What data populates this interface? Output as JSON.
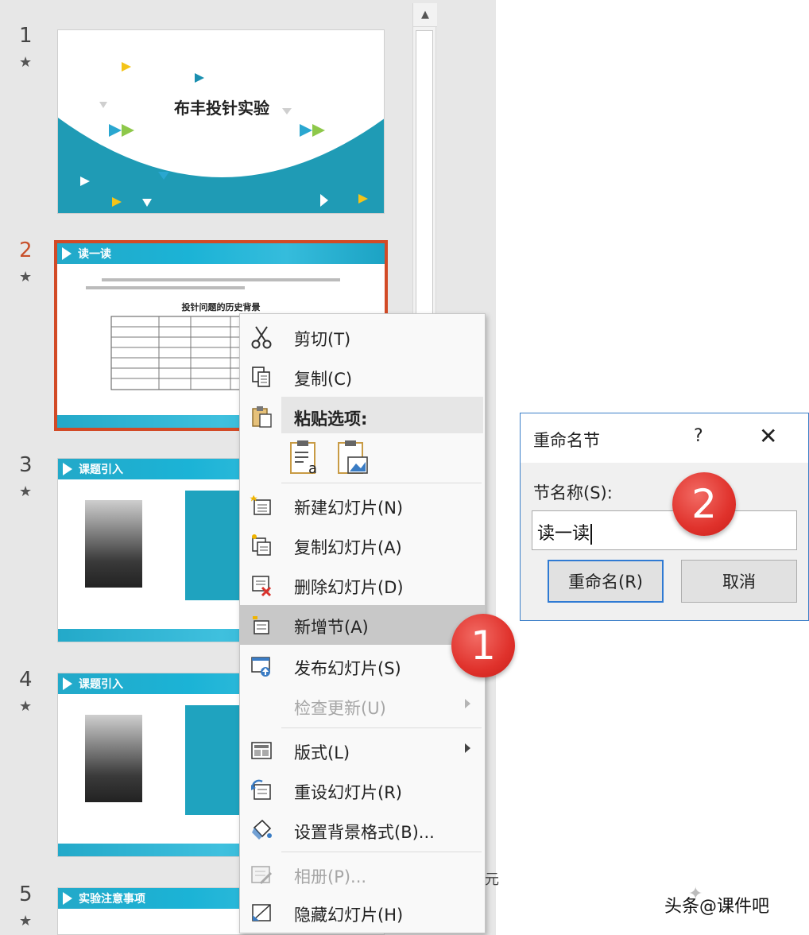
{
  "slides": [
    {
      "num": "1",
      "title": "布丰投针实验"
    },
    {
      "num": "2",
      "title": "读一读",
      "subtitle": "投针问题的历史背景"
    },
    {
      "num": "3",
      "title": "课题引入"
    },
    {
      "num": "4",
      "title": "课题引入"
    },
    {
      "num": "5",
      "title": "实验注意事项"
    }
  ],
  "star": "★",
  "context_menu": {
    "cut": "剪切(T)",
    "copy": "复制(C)",
    "paste_options": "粘贴选项:",
    "new_slide": "新建幻灯片(N)",
    "duplicate_slide": "复制幻灯片(A)",
    "delete_slide": "删除幻灯片(D)",
    "add_section": "新增节(A)",
    "publish_slides": "发布幻灯片(S)",
    "check_updates": "检查更新(U)",
    "layout": "版式(L)",
    "reset_slide": "重设幻灯片(R)",
    "format_background": "设置背景格式(B)...",
    "photo_album": "相册(P)...",
    "hide_slide": "隐藏幻灯片(H)"
  },
  "dialog": {
    "title": "重命名节",
    "help": "?",
    "close": "✕",
    "field_label": "节名称(S):",
    "field_value": "读一读",
    "ok_button": "重命名(R)",
    "cancel_button": "取消"
  },
  "badges": {
    "one": "1",
    "two": "2"
  },
  "watermark": "头条@课件吧",
  "edge_char": "元",
  "colors": {
    "accent": "#1bb3d6",
    "selection": "#d24a26",
    "badge": "#e0322c"
  }
}
